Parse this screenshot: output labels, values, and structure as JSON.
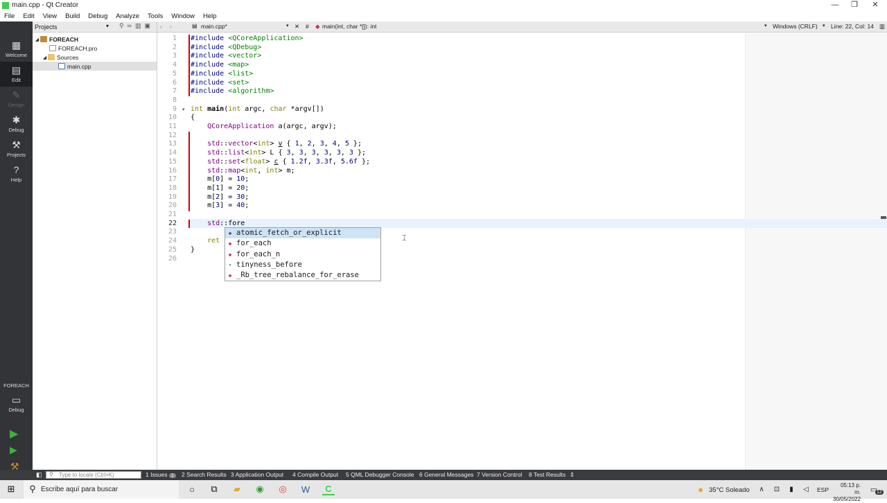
{
  "window": {
    "title": "main.cpp - Qt Creator"
  },
  "menu": [
    "File",
    "Edit",
    "View",
    "Build",
    "Debug",
    "Analyze",
    "Tools",
    "Window",
    "Help"
  ],
  "modes": [
    {
      "label": "Welcome",
      "icon": "grid-icon"
    },
    {
      "label": "Edit",
      "icon": "document-icon"
    },
    {
      "label": "Design",
      "icon": "pencil-icon"
    },
    {
      "label": "Debug",
      "icon": "bug-icon"
    },
    {
      "label": "Projects",
      "icon": "wrench-icon"
    },
    {
      "label": "Help",
      "icon": "help-icon"
    }
  ],
  "target": {
    "project": "FOREACH",
    "config": "Debug"
  },
  "projects_panel": {
    "title": "Projects",
    "tree": [
      {
        "label": "FOREACH",
        "level": 0
      },
      {
        "label": "FOREACH.pro",
        "level": 1
      },
      {
        "label": "Sources",
        "level": 1
      },
      {
        "label": "main.cpp",
        "level": 2
      }
    ]
  },
  "editor": {
    "file_tab": "main.cpp*",
    "symbol": "main(int, char *[]): int",
    "line_ending": "Windows (CRLF)",
    "position": "Line: 22, Col: 14",
    "current_line": 22,
    "line_numbers": [
      "1",
      "2",
      "3",
      "4",
      "5",
      "6",
      "7",
      "8",
      "9",
      "10",
      "11",
      "12",
      "13",
      "14",
      "15",
      "16",
      "17",
      "18",
      "19",
      "20",
      "21",
      "22",
      "23",
      "24",
      "25",
      "26"
    ]
  },
  "completion": {
    "items": [
      {
        "label": "atomic_fetch_or_explicit",
        "kind": "function"
      },
      {
        "label": "for_each",
        "kind": "function"
      },
      {
        "label": "for_each_n",
        "kind": "function"
      },
      {
        "label": "tinyness_before",
        "kind": "variable"
      },
      {
        "label": "_Rb_tree_rebalance_for_erase",
        "kind": "function"
      }
    ],
    "selected": 0
  },
  "statusbar": {
    "locator_placeholder": "Type to locate (Ctrl+K)",
    "tabs": [
      "1  Issues",
      "2  Search Results",
      "3  Application Output",
      "4  Compile Output",
      "5  QML Debugger Console",
      "6  General Messages",
      "7  Version Control",
      "8  Test Results"
    ],
    "issues_count": "1"
  },
  "taskbar": {
    "search_placeholder": "Escribe aquí para buscar",
    "weather": "35°C  Soleado",
    "lang": "ESP",
    "time": "05:13 p. m.",
    "date": "30/05/2022",
    "notif_count": "12"
  },
  "colors": {
    "keyword": "#808000",
    "preprocessor": "#000080",
    "string": "#008000",
    "type": "#800080",
    "sidebar": "#333437",
    "current_line": "#e8f2fa",
    "completion_selected": "#cde4f7"
  }
}
